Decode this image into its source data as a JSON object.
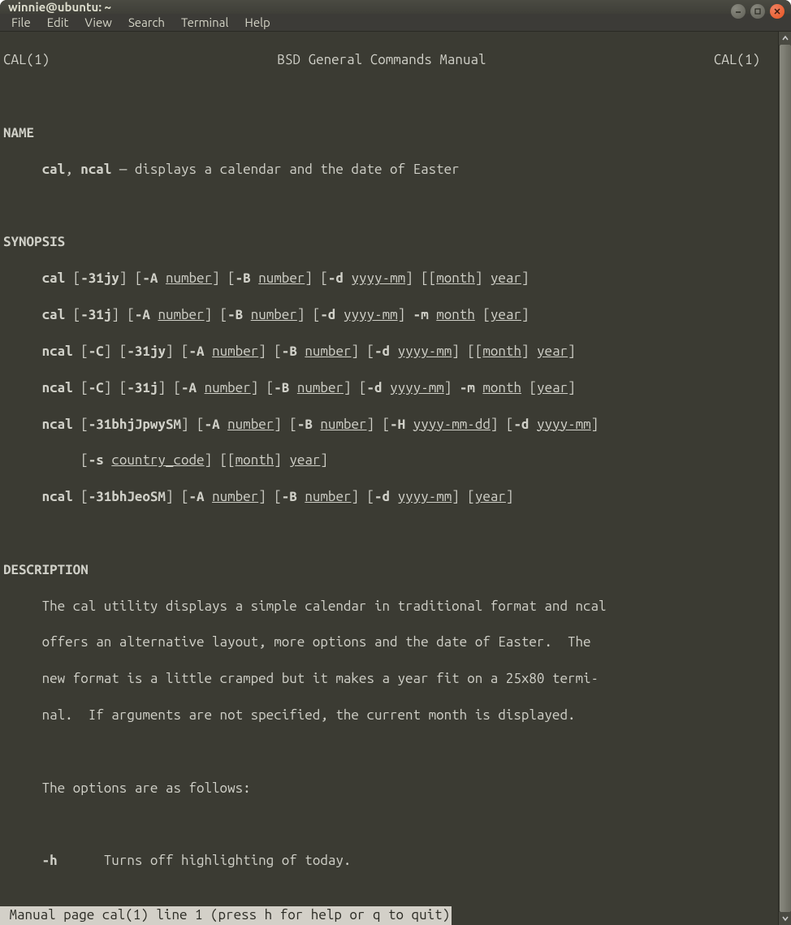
{
  "window": {
    "title": "winnie@ubuntu: ~"
  },
  "menubar": {
    "items": [
      "File",
      "Edit",
      "View",
      "Search",
      "Terminal",
      "Help"
    ]
  },
  "man": {
    "header_left": "CAL(1)",
    "header_center": "BSD General Commands Manual",
    "header_right": "CAL(1)",
    "name_hdr": "NAME",
    "name_line_pre": "     ",
    "name_cmd1": "cal",
    "name_sep": ", ",
    "name_cmd2": "ncal",
    "name_desc": " — displays a calendar and the date of Easter",
    "syn_hdr": "SYNOPSIS",
    "syn1_cmd": "cal",
    "syn1_a": " [",
    "syn1_flags1": "-31jy",
    "syn1_b": "] [",
    "syn1_A": "-A",
    "syn1_sp": " ",
    "syn1_num": "number",
    "syn1_c": "] [",
    "syn1_B": "-B",
    "syn1_d": "] [",
    "syn1_dflag": "-d",
    "syn1_ymm": "yyyy-mm",
    "syn1_e": "] [[",
    "syn1_month": "month",
    "syn1_f": "] ",
    "syn1_year": "year",
    "syn1_g": "]",
    "syn2_cmd": "cal",
    "syn2_flags1": "-31j",
    "syn2_mflag": "-m",
    "syn2_month": "month",
    "syn2_year": "year",
    "syn3_cmd": "ncal",
    "syn3_Cflag": "-C",
    "syn4_cmd": "ncal",
    "syn5_cmd": "ncal",
    "syn5_flags1": "-31bhjJpwySM",
    "syn5_Hflag": "-H",
    "syn5_ymd": "yyyy-mm-dd",
    "syn5_sflag": "-s",
    "syn5_cc": "country_code",
    "syn6_cmd": "ncal",
    "syn6_flags1": "-31bhJeoSM",
    "desc_hdr": "DESCRIPTION",
    "desc1": "     The cal utility displays a simple calendar in traditional format and ncal",
    "desc2": "     offers an alternative layout, more options and the date of Easter.  The",
    "desc3": "     new format is a little cramped but it makes a year fit on a 25x80 termi-",
    "desc4": "     nal.  If arguments are not specified, the current month is displayed.",
    "desc5": "     The options are as follows:",
    "opt_h_flag": "-h",
    "opt_h_desc": "Turns off highlighting of today.",
    "status": " Manual page cal(1) line 1 (press h for help or q to quit)"
  }
}
